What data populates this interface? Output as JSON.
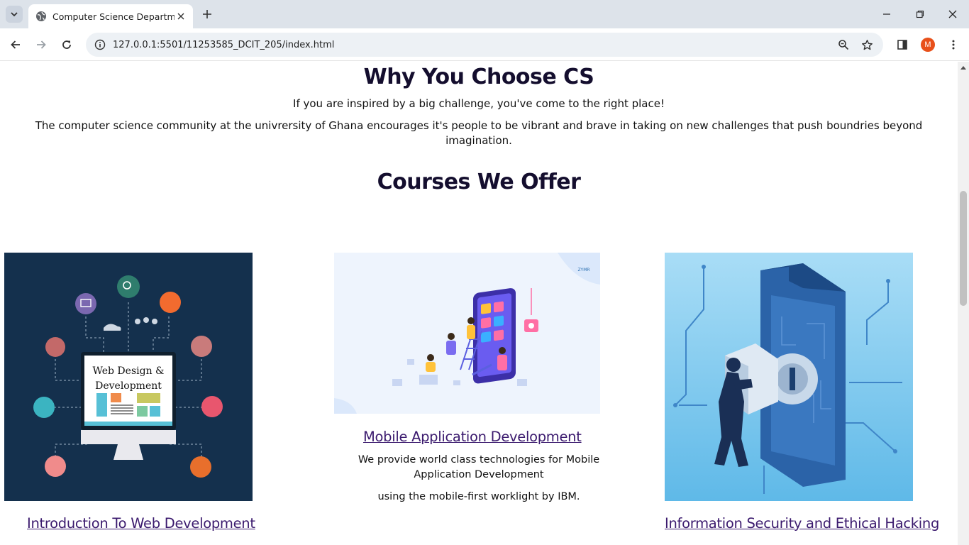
{
  "browser": {
    "tab_title": "Computer Science Department",
    "url": "127.0.0.1:5501/11253585_DCIT_205/index.html",
    "profile_initial": "M"
  },
  "icons": {
    "tab_search": "chevron-down-icon",
    "favicon": "globe-icon",
    "tab_close": "close-icon",
    "new_tab": "plus-icon",
    "back": "arrow-left-icon",
    "forward": "arrow-right-icon",
    "reload": "reload-icon",
    "site_info": "info-icon",
    "zoom": "zoom-icon",
    "bookmark": "star-icon",
    "side_panel": "side-panel-icon",
    "menu": "kebab-menu-icon"
  },
  "page": {
    "why_title": "Why You Choose CS",
    "why_line1": "If you are inspired by a big challenge, you've come to the right place!",
    "why_line2": "The computer science community at the univrersity of Ghana encourages it's people to be vibrant and brave in taking on new challenges that push boundries beyond imagination.",
    "courses_title": "Courses We Offer",
    "courses": [
      {
        "title": "Introduction To Web Development",
        "image_text_1": "Web Design &",
        "image_text_2": "Development"
      },
      {
        "title": "Mobile Application Development",
        "description": "We provide world class technologies for Mobile Application Development",
        "description2": "using the mobile-first worklight by IBM.",
        "image_brand": "ZYMR"
      },
      {
        "title": "Information Security and Ethical Hacking"
      }
    ]
  },
  "colors": {
    "heading": "#140e2e",
    "link": "#3b1a6e",
    "web_card_bg": "#14304d",
    "mobile_card_bg": "#eef4fd",
    "security_card_bg": "#7ccdf2"
  }
}
